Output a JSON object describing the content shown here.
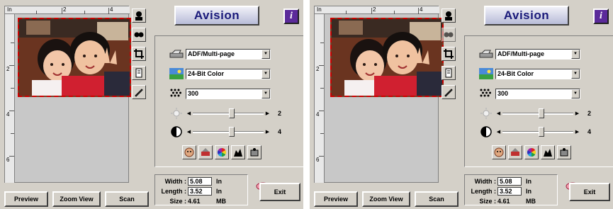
{
  "brand": "Avision",
  "info_icon": "i",
  "ruler": {
    "unit": "In",
    "top_marks": [
      "2",
      "4"
    ],
    "left_marks": [
      "2",
      "4",
      "6"
    ]
  },
  "scan_source": "ADF/Multi-page",
  "image_type": "24-Bit Color",
  "resolution": "300",
  "brightness": {
    "value": "2",
    "level": 0.55
  },
  "contrast": {
    "value": "4",
    "level": 0.55
  },
  "width_label": "Width :",
  "width_value": "5.08",
  "length_label": "Length :",
  "length_value": "3.52",
  "size_label": "Size :",
  "size_value": "4.61",
  "unit_in": "In",
  "unit_mb": "MB",
  "buttons": {
    "preview": "Preview",
    "zoom_view": "Zoom View",
    "scan": "Scan",
    "exit": "Exit"
  },
  "tool_icons": [
    "scanner-silhouette-icon",
    "flip-icon",
    "crop-icon",
    "document-icon",
    "pencil-icon"
  ],
  "fx_icons": [
    "face-icon",
    "fx-color-icon",
    "color-wheel-icon",
    "histogram-icon",
    "settings-icon"
  ],
  "colors": {
    "frame": "#d4d0c8",
    "brand_text": "#1a1a7a",
    "info_button": "#5b2a9a",
    "crop_border": "#cc0000"
  }
}
